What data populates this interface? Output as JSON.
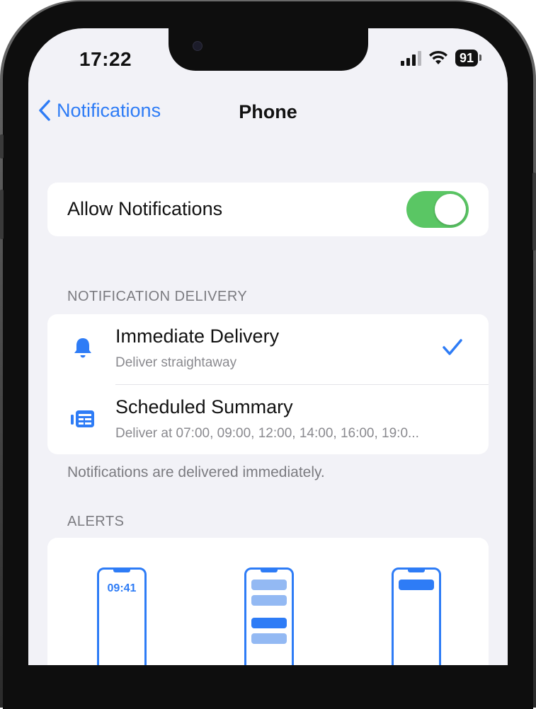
{
  "status_bar": {
    "time": "17:22",
    "battery": "91"
  },
  "nav": {
    "back_label": "Notifications",
    "title": "Phone"
  },
  "allow": {
    "label": "Allow Notifications",
    "enabled": true
  },
  "delivery": {
    "section_title": "NOTIFICATION DELIVERY",
    "options": [
      {
        "title": "Immediate Delivery",
        "subtitle": "Deliver straightaway",
        "selected": true
      },
      {
        "title": "Scheduled Summary",
        "subtitle": "Deliver at 07:00, 09:00, 12:00, 14:00, 16:00, 19:0...",
        "selected": false
      }
    ],
    "footer": "Notifications are delivered immediately."
  },
  "alerts": {
    "section_title": "ALERTS",
    "lock_screen_time": "09:41"
  },
  "colors": {
    "accent": "#2e7cf6",
    "toggle_on": "#5ac664",
    "background": "#f2f2f7"
  }
}
